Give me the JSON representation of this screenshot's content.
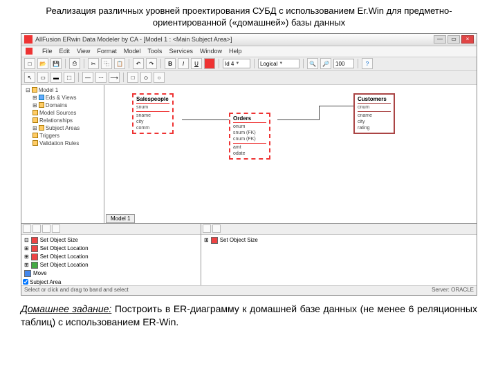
{
  "slide": {
    "title": "Реализация различных уровней проектирования СУБД с использованием Er.Win для предметно-ориентированной («домашней») базы данных"
  },
  "window": {
    "title": "AllFusion ERwin Data Modeler by CA - [Model 1 : <Main Subject Area>]"
  },
  "menu": {
    "file": "File",
    "edit": "Edit",
    "view": "View",
    "format": "Format",
    "model": "Model",
    "tools": "Tools",
    "services": "Services",
    "window": "Window",
    "help": "Help"
  },
  "toolbar": {
    "id_field": "Id 4",
    "logical": "Logical",
    "zoom": "100"
  },
  "tree": {
    "root": "Model 1",
    "n1": "Eds & Views",
    "n2": "Domains",
    "n3": "Model Sources",
    "n4": "Relationships",
    "n5": "Subject Areas",
    "n6": "Triggers",
    "n7": "Validation Rules"
  },
  "entities": {
    "salespeople": {
      "name": "Salespeople",
      "a1": "snum",
      "a2": "sname",
      "a3": "city",
      "a4": "comm"
    },
    "orders": {
      "name": "Orders",
      "a1": "onum",
      "a2": "snum (FK)",
      "a3": "cnum (FK)",
      "a4": "amt",
      "a5": "odate"
    },
    "customers": {
      "name": "Customers",
      "a1": "cnum",
      "a2": "cname",
      "a3": "city",
      "a4": "rating"
    }
  },
  "canvas": {
    "subject_area_cb": "Subject Area",
    "tab": "Model 1"
  },
  "actions": {
    "a1": "Set Object Size",
    "a2": "Set Object Location",
    "a3": "Set Object Location",
    "a4": "Set Object Location",
    "a5": "Move",
    "b1": "Set Object Size"
  },
  "status": {
    "left": "Select or click and drag to band and select",
    "right": "Server: ORACLE"
  },
  "homework": {
    "label": "Домашнее задание:",
    "text": " Построить в ER-диаграмму к домашней базе данных (не менее 6 реляционных таблиц) с использованием ER-Win."
  }
}
